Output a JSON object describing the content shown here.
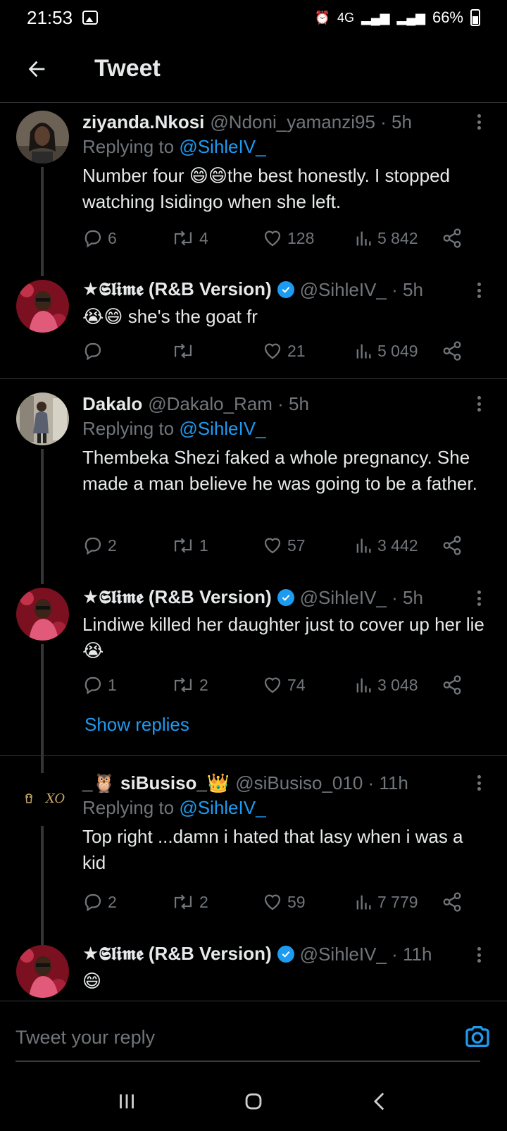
{
  "status_bar": {
    "time": "21:53",
    "network": "4G",
    "battery": "66%"
  },
  "header": {
    "title": "Tweet"
  },
  "tweets": [
    {
      "name": "ziyanda.Nkosi",
      "handle": "@Ndoni_yamanzi95 · 5h",
      "replying_prefix": "Replying to ",
      "replying_to": "@SihleIV_",
      "text": "Number four 😄😄the best honestly. I stopped watching Isidingo when she left.",
      "replies": "6",
      "retweets": "4",
      "likes": "128",
      "views": "5 842"
    },
    {
      "name": "★𝕾𝖑𝖎𝖒𝖊 (R&B Version)",
      "handle": "@SihleIV_ · 5h",
      "verified": true,
      "text": "😭😄 she's the goat fr",
      "replies": "",
      "retweets": "",
      "likes": "21",
      "views": "5 049"
    },
    {
      "name": "Dakalo",
      "handle": "@Dakalo_Ram · 5h",
      "replying_prefix": "Replying to ",
      "replying_to": "@SihleIV_",
      "text": "Thembeka Shezi faked a whole pregnancy. She made a man believe he was going to be a father.",
      "replies": "2",
      "retweets": "1",
      "likes": "57",
      "views": "3 442"
    },
    {
      "name": "★𝕾𝖑𝖎𝖒𝖊 (R&B Version)",
      "handle": "@SihleIV_ · 5h",
      "verified": true,
      "text": "Lindiwe killed her daughter just to cover up her lie 😭",
      "replies": "1",
      "retweets": "2",
      "likes": "74",
      "views": "3 048"
    },
    {
      "name": "_🦉 siBusiso_👑",
      "handle": "@siBusiso_010 · 11h",
      "replying_prefix": "Replying to ",
      "replying_to": "@SihleIV_",
      "text": "Top right ...damn i hated that lasy when i was a kid",
      "replies": "2",
      "retweets": "2",
      "likes": "59",
      "views": "7 779"
    },
    {
      "name": "★𝕾𝖑𝖎𝖒𝖊 (R&B Version)",
      "handle": "@SihleIV_ · 11h",
      "verified": true,
      "text": "😄"
    }
  ],
  "show_replies": "Show replies",
  "avatar_text_sibusiso": "XO",
  "reply_box": {
    "placeholder": "Tweet your reply"
  },
  "colors": {
    "accent": "#1d9bf0",
    "background": "#000000",
    "muted": "#71767b"
  }
}
